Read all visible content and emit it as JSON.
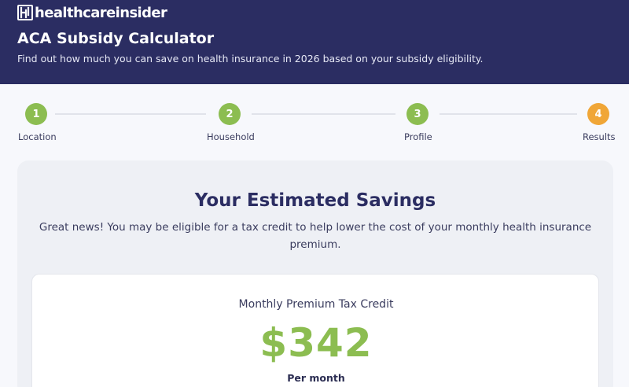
{
  "header": {
    "logo_text": "healthcareinsider",
    "title": "ACA Subsidy Calculator",
    "subtitle": "Find out how much you can save on health insurance in 2026 based on your subsidy eligibility."
  },
  "stepper": {
    "steps": [
      {
        "number": "1",
        "label": "Location",
        "status": "complete"
      },
      {
        "number": "2",
        "label": "Household",
        "status": "complete"
      },
      {
        "number": "3",
        "label": "Profile",
        "status": "complete"
      },
      {
        "number": "4",
        "label": "Results",
        "status": "current"
      }
    ]
  },
  "results": {
    "title": "Your Estimated Savings",
    "description": "Great news! You may be eligible for a tax credit to help lower the cost of your monthly health insurance premium.",
    "credit_label": "Monthly Premium Tax Credit",
    "credit_amount": "$342",
    "credit_unit": "Per month"
  },
  "colors": {
    "header_bg": "#2b2d62",
    "step_complete": "#8cbd51",
    "step_current": "#f0a637",
    "amount": "#8cbd51"
  }
}
